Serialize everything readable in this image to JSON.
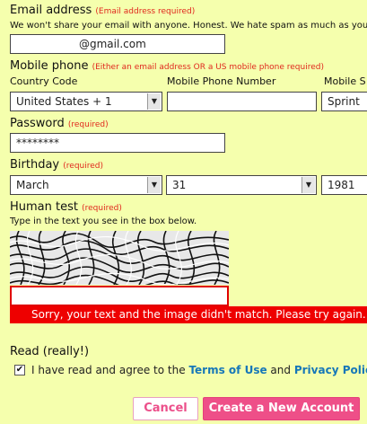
{
  "email": {
    "label": "Email address",
    "required": "(Email address required)",
    "note": "We won't share your email with anyone. Honest. We hate spam as much as you do.",
    "value": "@gmail.com"
  },
  "mobile": {
    "label": "Mobile phone",
    "required": "(Either an email address OR a US mobile phone required)",
    "country_label": "Country Code",
    "country_value": "United States + 1",
    "number_label": "Mobile Phone Number",
    "number_value": "",
    "carrier_label": "Mobile S",
    "carrier_value": "Sprint"
  },
  "password": {
    "label": "Password",
    "required": "(required)",
    "value": "********"
  },
  "birthday": {
    "label": "Birthday",
    "required": "(required)",
    "month": "March",
    "day": "31",
    "year": "1981"
  },
  "human": {
    "label": "Human test",
    "required": "(required)",
    "instruction": "Type in the text you see in the box below.",
    "value": "",
    "error": "Sorry, your text and the image didn't match. Please try again."
  },
  "terms": {
    "heading": "Read (really!)",
    "checked": true,
    "text_before": "I have read and agree to the",
    "terms_link": "Terms of Use",
    "and": "and",
    "privacy_link": "Privacy Policy",
    "period": "."
  },
  "buttons": {
    "cancel": "Cancel",
    "create": "Create a New Account"
  },
  "colors": {
    "background": "#f5ffad",
    "required_text": "#e0281e",
    "error_bar": "#ee0000",
    "link": "#1677b8",
    "accent": "#ee4f88"
  }
}
